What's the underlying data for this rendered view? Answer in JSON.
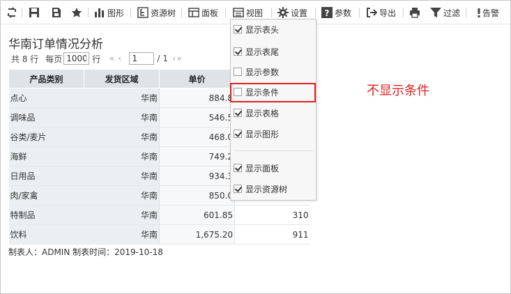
{
  "toolbar": {
    "chart": "图形",
    "resource_tree": "资源树",
    "panel": "面板",
    "view": "视图",
    "settings": "设置",
    "params": "参数",
    "export": "导出",
    "filter": "过滤",
    "alert": "告警"
  },
  "report": {
    "title": "华南订单情况分析",
    "pager": {
      "total_prefix": "共 8 行",
      "per_page_label": "每页",
      "per_page_value": "1000",
      "rows_unit": "行",
      "current_page": "1",
      "total_pages": "/ 1"
    },
    "columns": [
      "产品类别",
      "发货区域",
      "单价",
      ""
    ],
    "rows": [
      [
        "点心",
        "华南",
        "884.8",
        ""
      ],
      [
        "调味品",
        "华南",
        "546.5",
        ""
      ],
      [
        "谷类/麦片",
        "华南",
        "468.0",
        ""
      ],
      [
        "海鲜",
        "华南",
        "749.2",
        ""
      ],
      [
        "日用品",
        "华南",
        "934.3",
        ""
      ],
      [
        "肉/家禽",
        "华南",
        "850.0",
        ""
      ],
      [
        "特制品",
        "华南",
        "601.85",
        "310"
      ],
      [
        "饮料",
        "华南",
        "1,675.20",
        "911"
      ]
    ],
    "footer": "制表人：ADMIN  制表时间：2019-10-18"
  },
  "view_menu": {
    "items": [
      {
        "label": "显示表头",
        "checked": true
      },
      {
        "label": "显示表尾",
        "checked": true
      },
      {
        "label": "显示参数",
        "checked": false
      },
      {
        "label": "显示条件",
        "checked": false
      },
      {
        "label": "显示表格",
        "checked": true
      },
      {
        "label": "显示图形",
        "checked": true
      },
      {
        "label": "显示面板",
        "checked": true
      },
      {
        "label": "显示资源树",
        "checked": true
      }
    ]
  },
  "annotation": "不显示条件",
  "colors": {
    "accent_red": "#e02020",
    "header_bg": "#dfe3e6",
    "toolbar_icon": "#444444"
  }
}
